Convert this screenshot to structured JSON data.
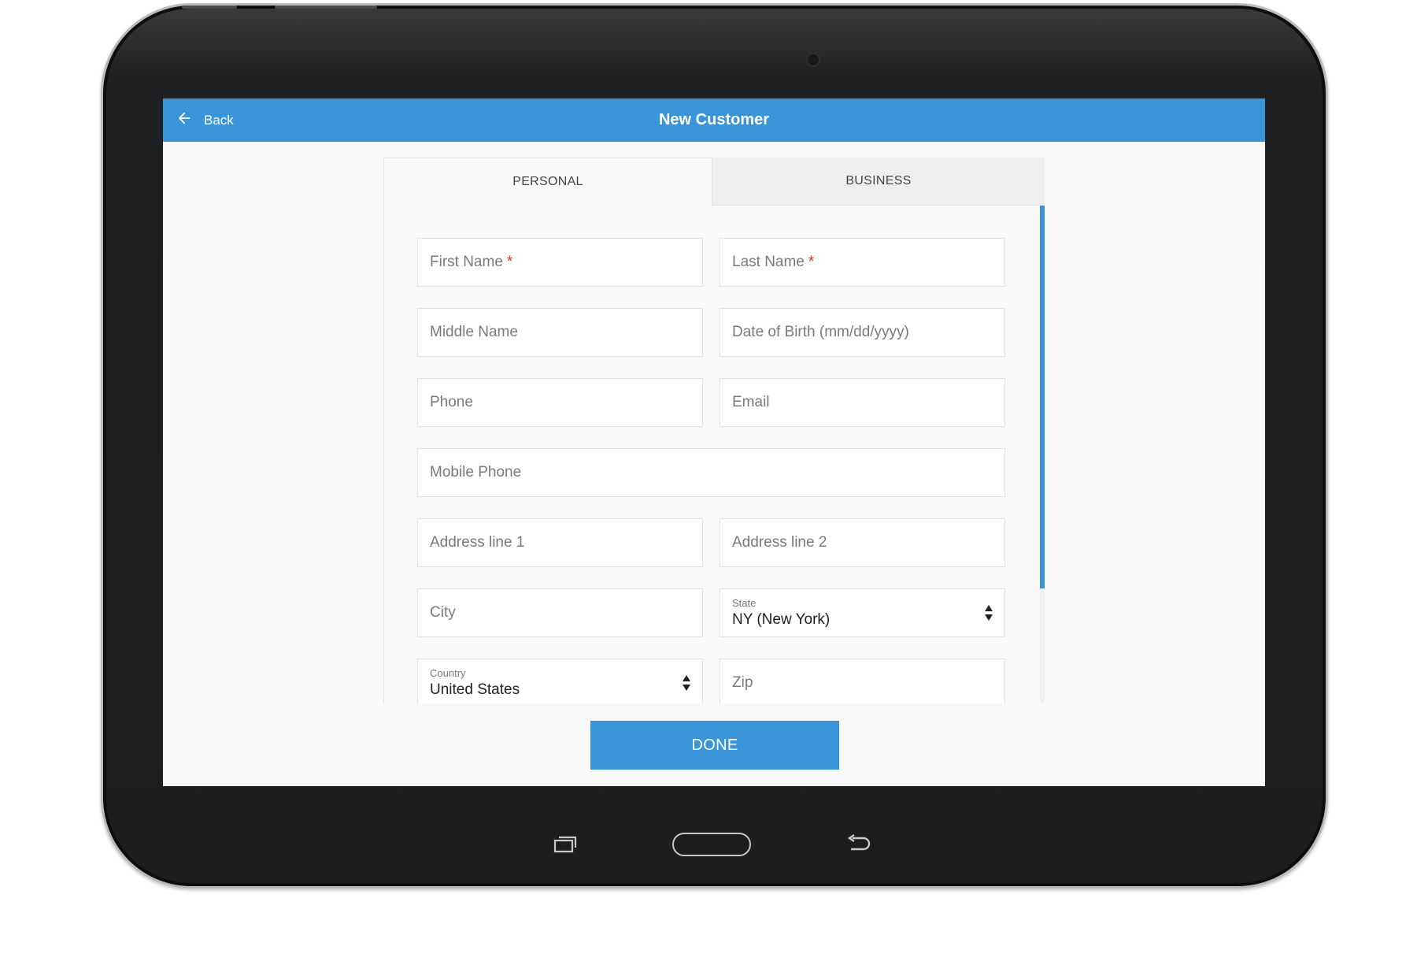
{
  "header": {
    "back_label": "Back",
    "title": "New Customer"
  },
  "tabs": [
    {
      "label": "PERSONAL",
      "active": true
    },
    {
      "label": "BUSINESS",
      "active": false
    }
  ],
  "form": {
    "first_name": {
      "placeholder": "First Name",
      "required_mark": "*",
      "value": ""
    },
    "last_name": {
      "placeholder": "Last Name",
      "required_mark": "*",
      "value": ""
    },
    "middle_name": {
      "placeholder": "Middle Name",
      "value": ""
    },
    "dob": {
      "placeholder": "Date of Birth (mm/dd/yyyy)",
      "value": ""
    },
    "phone": {
      "placeholder": "Phone",
      "value": ""
    },
    "email": {
      "placeholder": "Email",
      "value": ""
    },
    "mobile_phone": {
      "placeholder": "Mobile Phone",
      "value": ""
    },
    "address1": {
      "placeholder": "Address line 1",
      "value": ""
    },
    "address2": {
      "placeholder": "Address line 2",
      "value": ""
    },
    "city": {
      "placeholder": "City",
      "value": ""
    },
    "state": {
      "label": "State",
      "value": "NY (New York)"
    },
    "country": {
      "label": "Country",
      "value": "United States"
    },
    "zip": {
      "placeholder": "Zip",
      "value": ""
    }
  },
  "actions": {
    "done_label": "DONE"
  },
  "colors": {
    "accent": "#3a95d8",
    "required": "#e0342b",
    "background": "#f9f9f9"
  },
  "icons": {
    "back": "arrow-left-icon",
    "select": "up-down-arrows-icon",
    "nav_recent": "recent-apps-icon",
    "nav_home": "home-button",
    "nav_back": "back-arrow-icon"
  }
}
